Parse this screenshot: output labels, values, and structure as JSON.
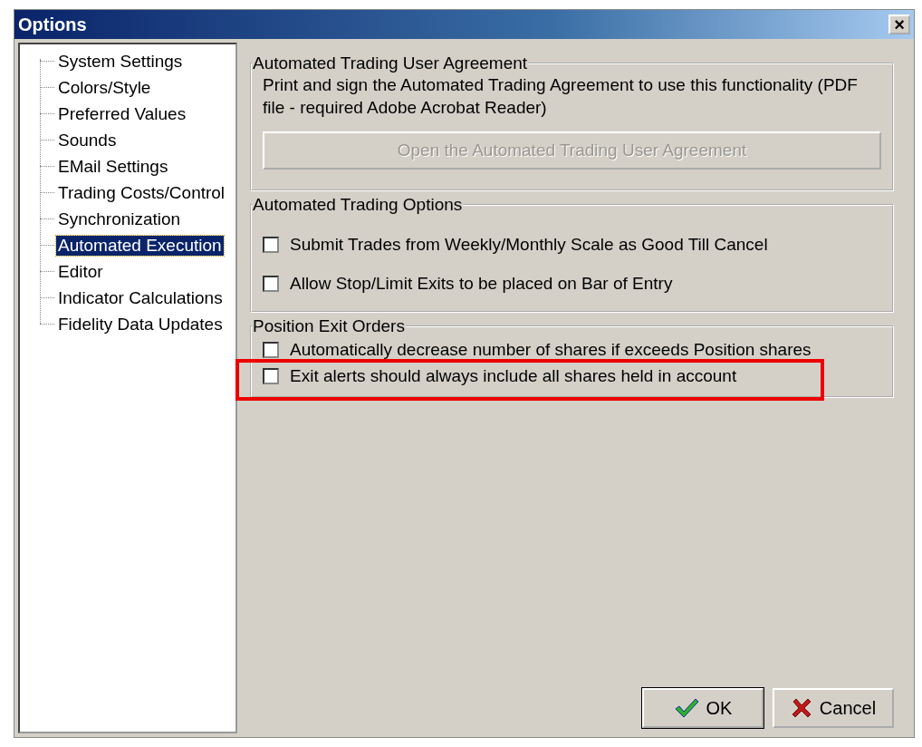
{
  "window": {
    "title": "Options",
    "close": "×"
  },
  "sidebar": {
    "items": [
      {
        "label": "System Settings",
        "selected": false
      },
      {
        "label": "Colors/Style",
        "selected": false
      },
      {
        "label": "Preferred Values",
        "selected": false
      },
      {
        "label": "Sounds",
        "selected": false
      },
      {
        "label": "EMail Settings",
        "selected": false
      },
      {
        "label": "Trading Costs/Control",
        "selected": false
      },
      {
        "label": "Synchronization",
        "selected": false
      },
      {
        "label": "Automated Execution",
        "selected": true
      },
      {
        "label": "Editor",
        "selected": false
      },
      {
        "label": "Indicator Calculations",
        "selected": false
      },
      {
        "label": "Fidelity Data Updates",
        "selected": false
      }
    ]
  },
  "groups": [
    {
      "title": "Automated Trading User Agreement",
      "text": "Print and sign the Automated Trading Agreement to use this functionality (PDF file - required Adobe Acrobat Reader)",
      "button": {
        "label": "Open the Automated Trading User Agreement",
        "disabled": true
      }
    },
    {
      "title": "Automated Trading Options",
      "options": [
        {
          "label": "Submit Trades from Weekly/Monthly Scale as Good Till Cancel",
          "checked": false
        },
        {
          "label": "Allow Stop/Limit Exits to be placed on Bar of Entry",
          "checked": false
        }
      ]
    },
    {
      "title": "Position Exit Orders",
      "options": [
        {
          "label": "Automatically decrease number of shares if exceeds Position shares",
          "checked": false
        },
        {
          "label": "Exit alerts should always include all shares held in account",
          "checked": false,
          "highlighted": true
        }
      ]
    }
  ],
  "buttons": [
    {
      "kind": "ok",
      "label": "OK"
    },
    {
      "kind": "cancel",
      "label": "Cancel"
    }
  ]
}
